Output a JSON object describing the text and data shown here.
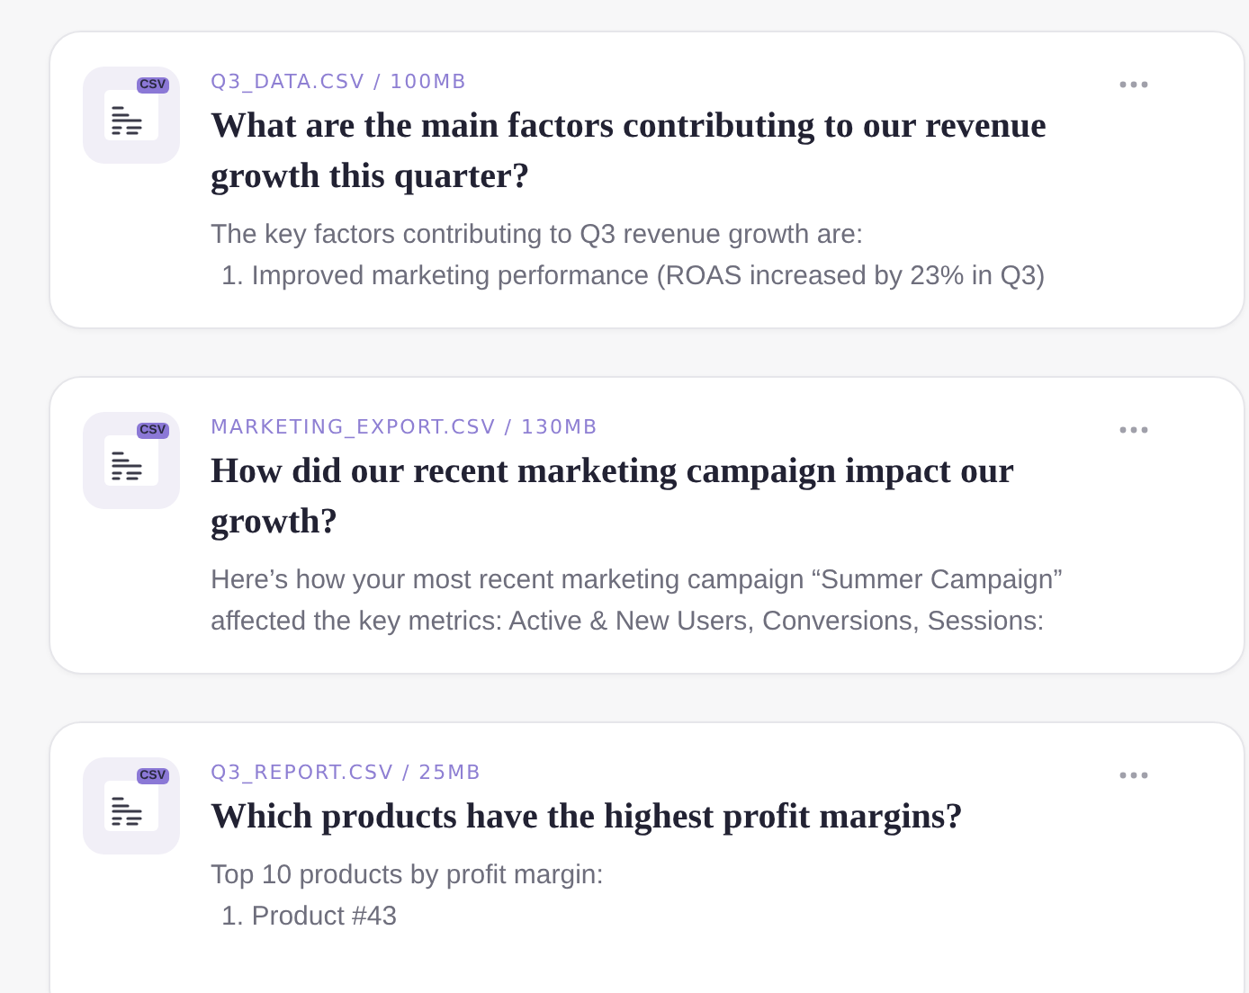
{
  "cards": [
    {
      "badge": "CSV",
      "file": "Q3_DATA.CSV / 100MB",
      "title": "What are the main factors contributing to our revenue growth this quarter?",
      "summary": "The key factors contributing to Q3 revenue growth are:",
      "list": [
        {
          "num": "1.",
          "text": "Improved marketing performance (ROAS increased by 23% in Q3)"
        }
      ]
    },
    {
      "badge": "CSV",
      "file": "MARKETING_EXPORT.CSV / 130MB",
      "title": "How did our recent marketing campaign impact our growth?",
      "summary": "Here’s how your most recent marketing campaign “Summer Campaign” affected the key metrics: Active & New Users, Conversions, Sessions:"
    },
    {
      "badge": "CSV",
      "file": "Q3_REPORT.CSV / 25MB",
      "title": "Which products have the highest profit margins?",
      "summary": "Top 10 products by profit margin:",
      "list": [
        {
          "num": "1.",
          "text": "Product #43"
        }
      ]
    }
  ]
}
